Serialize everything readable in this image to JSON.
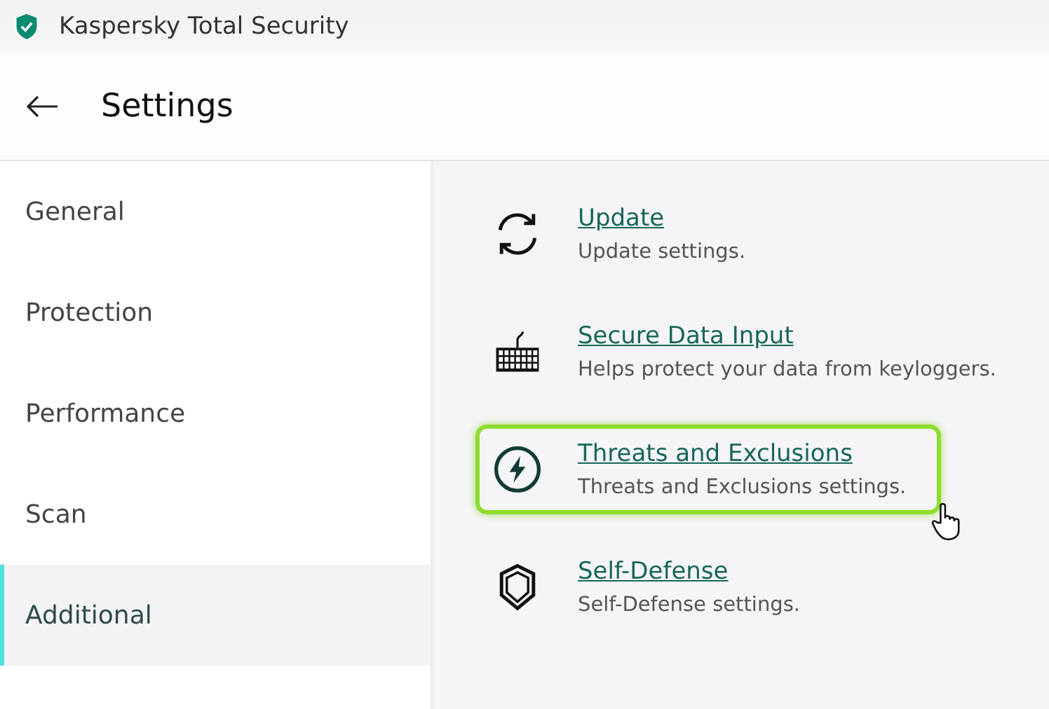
{
  "window": {
    "title": "Kaspersky Total Security"
  },
  "header": {
    "title": "Settings"
  },
  "sidebar": {
    "items": [
      {
        "label": "General",
        "selected": false
      },
      {
        "label": "Protection",
        "selected": false
      },
      {
        "label": "Performance",
        "selected": false
      },
      {
        "label": "Scan",
        "selected": false
      },
      {
        "label": "Additional",
        "selected": true
      }
    ]
  },
  "sections": [
    {
      "kind": "refresh",
      "title": "Update",
      "description": "Update settings.",
      "highlighted": false
    },
    {
      "kind": "keyboard",
      "title": "Secure Data Input",
      "description": "Helps protect your data from keyloggers.",
      "highlighted": false
    },
    {
      "kind": "bolt",
      "title": "Threats and Exclusions",
      "description": "Threats and Exclusions settings.",
      "highlighted": true
    },
    {
      "kind": "shield",
      "title": "Self-Defense",
      "description": "Self-Defense settings.",
      "highlighted": false
    }
  ]
}
